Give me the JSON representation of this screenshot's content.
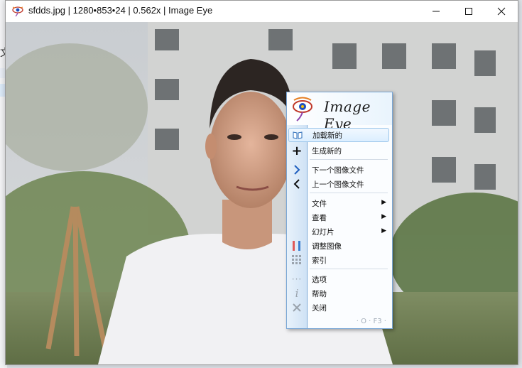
{
  "window": {
    "title": "sfdds.jpg | 1280•853•24 | 0.562x | Image Eye"
  },
  "behind_app": {
    "glyph": "文"
  },
  "menu": {
    "logo_text": "Image Eye",
    "items": [
      {
        "label": "加载新的",
        "icon": "book-open-icon",
        "highlighted": true
      },
      {
        "label": "生成新的",
        "icon": "plus-icon"
      },
      {
        "label": "下一个图像文件",
        "icon": "chevron-right-icon"
      },
      {
        "label": "上一个图像文件",
        "icon": "chevron-left-icon"
      },
      {
        "label": "文件",
        "submenu": true
      },
      {
        "label": "查看",
        "submenu": true
      },
      {
        "label": "幻灯片",
        "submenu": true
      },
      {
        "label": "调整图像",
        "icon": "adjust-bars-icon",
        "annotated": true
      },
      {
        "label": "索引",
        "icon": "grid-icon"
      },
      {
        "label": "选项",
        "icon": "dots-icon"
      },
      {
        "label": "帮助",
        "icon": "info-icon"
      },
      {
        "label": "关闭",
        "icon": "close-x-icon"
      }
    ],
    "submenu_arrow": "▶",
    "footer": "· O · F3 ·"
  },
  "colors": {
    "menu_border": "#7aa7d6",
    "annotation": "#e03030",
    "accent": "#1f6fd1"
  }
}
